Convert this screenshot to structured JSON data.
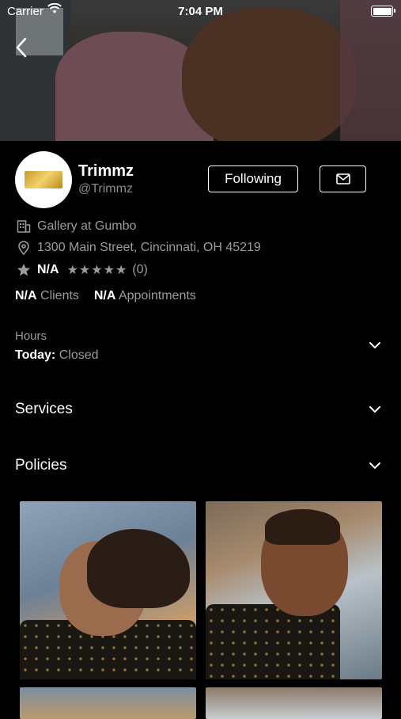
{
  "status_bar": {
    "carrier": "Carrier",
    "time": "7:04 PM"
  },
  "icons": {
    "back": "chevron-left-icon",
    "wifi": "wifi-icon",
    "battery": "battery-icon",
    "building": "building-icon",
    "location": "location-pin-icon",
    "star": "star-icon",
    "mail": "mail-icon",
    "chevron": "chevron-down-icon"
  },
  "profile": {
    "name": "Trimmz",
    "handle": "@Trimmz",
    "logo_text": "Trimmz",
    "follow_label": "Following"
  },
  "details": {
    "gallery_name": "Gallery at Gumbo",
    "address": "1300 Main Street, Cincinnati, OH 45219",
    "rating_value": "N/A",
    "rating_stars": "★★★★★",
    "rating_count": "(0)"
  },
  "stats": {
    "clients_value": "N/A",
    "clients_label": "Clients",
    "appointments_value": "N/A",
    "appointments_label": "Appointments"
  },
  "hours": {
    "title": "Hours",
    "today_label": "Today:",
    "today_value": "Closed"
  },
  "sections": {
    "services": "Services",
    "policies": "Policies"
  },
  "colors": {
    "background": "#000000",
    "text_primary": "#ffffff",
    "text_secondary": "#9b9b9b",
    "gold_logo": "#d9b04a"
  }
}
